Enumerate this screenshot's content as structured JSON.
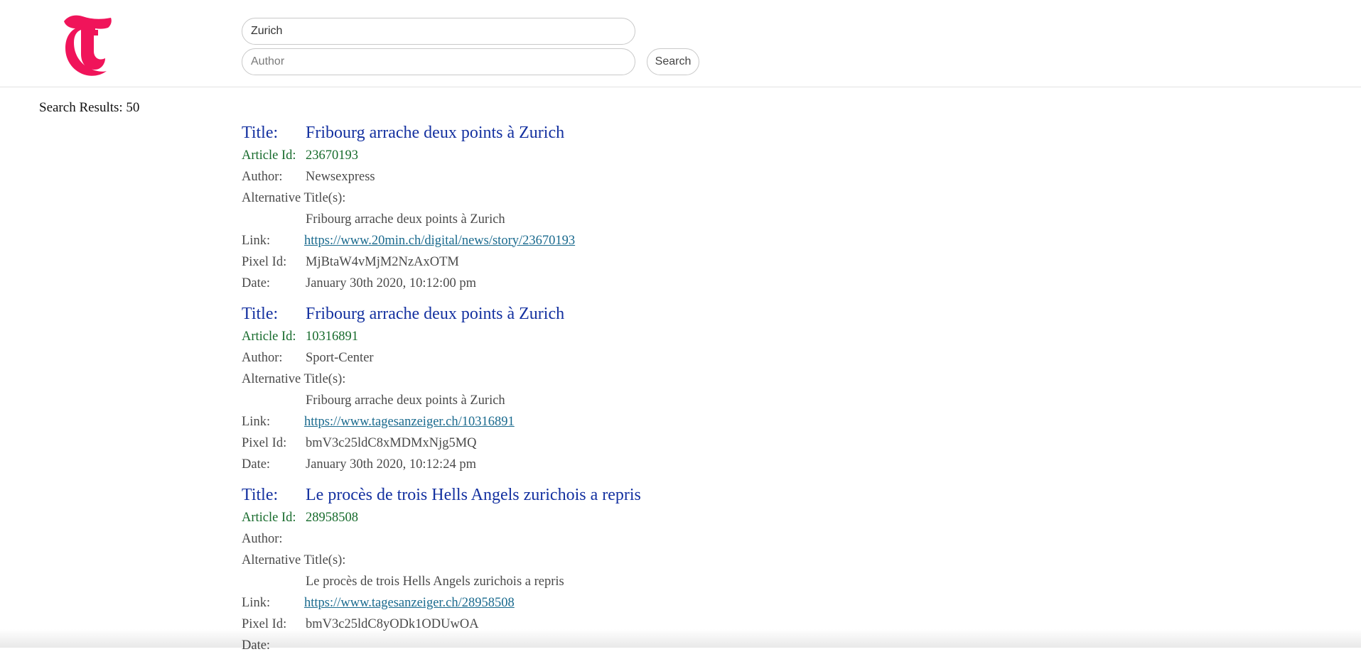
{
  "header": {
    "logo_alt": "T",
    "search": {
      "query_value": "Zurich",
      "author_placeholder": "Author",
      "author_value": "",
      "button_label": "Search"
    }
  },
  "results": {
    "count_text": "Search Results: 50",
    "labels": {
      "title": "Title:",
      "article_id": "Article Id:",
      "author": "Author:",
      "alt_titles": "Alternative Title(s):",
      "link": "Link:",
      "pixel_id": "Pixel Id:",
      "date": "Date:"
    },
    "articles": [
      {
        "title": "Fribourg arrache deux points à Zurich",
        "article_id": "23670193",
        "author": "Newsexpress",
        "alt_title": "Fribourg arrache deux points à Zurich",
        "link": "https://www.20min.ch/digital/news/story/23670193",
        "pixel_id": "MjBtaW4vMjM2NzAxOTM",
        "date": "January 30th 2020, 10:12:00 pm"
      },
      {
        "title": "Fribourg arrache deux points à Zurich",
        "article_id": "10316891",
        "author": "Sport-Center",
        "alt_title": "Fribourg arrache deux points à Zurich",
        "link": "https://www.tagesanzeiger.ch/10316891",
        "pixel_id": "bmV3c25ldC8xMDMxNjg5MQ",
        "date": "January 30th 2020, 10:12:24 pm"
      },
      {
        "title": "Le procès de trois Hells Angels zurichois a repris",
        "article_id": "28958508",
        "author": "",
        "alt_title": "Le procès de trois Hells Angels zurichois a repris",
        "link": "https://www.tagesanzeiger.ch/28958508",
        "pixel_id": "bmV3c25ldC8yODk1ODUwOA",
        "date": ""
      }
    ]
  },
  "colors": {
    "brand": "#f0145a",
    "title": "#1431a0",
    "article_id": "#176b2c",
    "link": "#1a6a8e"
  }
}
